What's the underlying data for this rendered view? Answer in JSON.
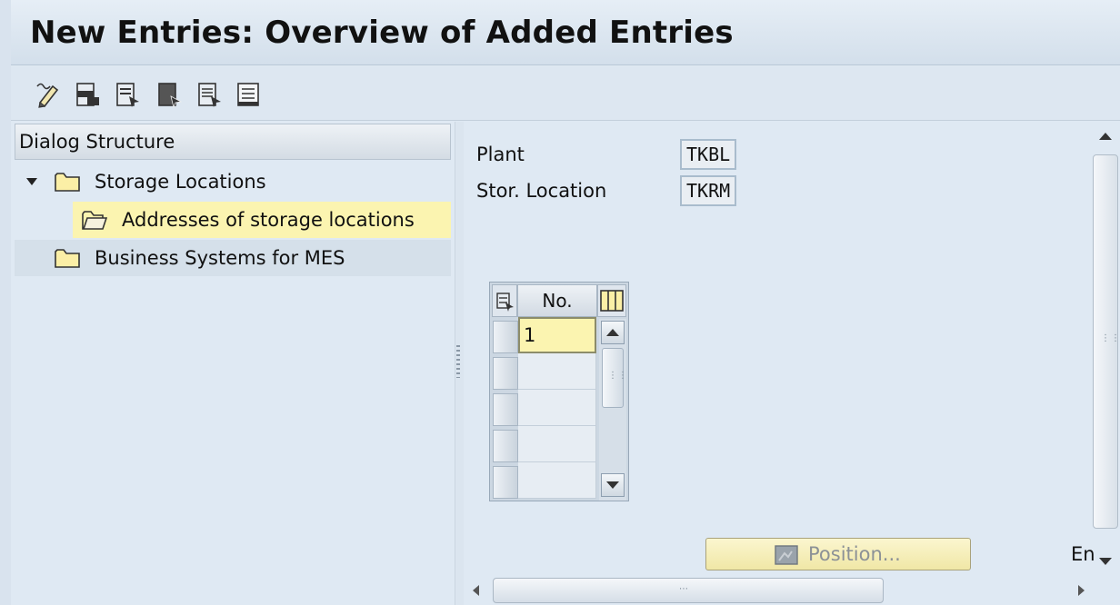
{
  "window": {
    "title": "New Entries: Overview of Added Entries"
  },
  "toolbar": {
    "buttons": [
      {
        "icon": "change-display-icon"
      },
      {
        "icon": "select-all-icon"
      },
      {
        "icon": "select-block-icon"
      },
      {
        "icon": "deselect-all-icon"
      },
      {
        "icon": "delete-entries-icon"
      },
      {
        "icon": "detail-icon"
      }
    ]
  },
  "dialog_structure": {
    "header": "Dialog Structure",
    "items": [
      {
        "label": "Storage Locations",
        "expanded": true
      },
      {
        "label": "Addresses of storage locations",
        "selected": true
      },
      {
        "label": "Business Systems for MES"
      }
    ]
  },
  "fields": {
    "plant_label": "Plant",
    "plant_value": "TKBL",
    "stor_location_label": "Stor. Location",
    "stor_location_value": "TKRM"
  },
  "table": {
    "column_header": "No.",
    "rows": [
      "1",
      "",
      "",
      "",
      ""
    ]
  },
  "position_button": {
    "label": "Position..."
  },
  "footer": {
    "entry_text": "En"
  },
  "colors": {
    "background": "#dfe9f3",
    "selection_highlight": "#fbf4b0",
    "title_bar": "#d3dfeb"
  }
}
